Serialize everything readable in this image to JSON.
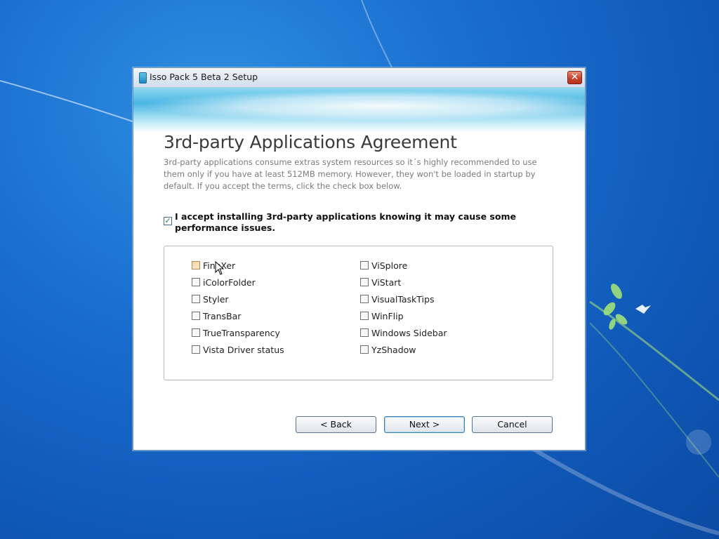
{
  "window": {
    "title": "Isso Pack 5 Beta 2 Setup",
    "close_glyph": "✕"
  },
  "page": {
    "heading": "3rd-party Applications Agreement",
    "description": "3rd-party applications consume extras system resources so it´s highly recommended to use them only if you have at least 512MB memory. However, they won't be loaded in startup by default. If you accept the terms, click the check box below."
  },
  "accept": {
    "checked": true,
    "label": "I accept installing 3rd-party applications knowing it may cause some performance issues."
  },
  "apps": {
    "left": [
      {
        "label": "FineXer",
        "checked": false
      },
      {
        "label": "iColorFolder",
        "checked": false
      },
      {
        "label": "Styler",
        "checked": false
      },
      {
        "label": "TransBar",
        "checked": false
      },
      {
        "label": "TrueTransparency",
        "checked": false
      },
      {
        "label": "Vista Driver status",
        "checked": false
      }
    ],
    "right": [
      {
        "label": "ViSplore",
        "checked": false
      },
      {
        "label": "ViStart",
        "checked": false
      },
      {
        "label": "VisualTaskTips",
        "checked": false
      },
      {
        "label": "WinFlip",
        "checked": false
      },
      {
        "label": "Windows Sidebar",
        "checked": false
      },
      {
        "label": "YzShadow",
        "checked": false
      }
    ]
  },
  "buttons": {
    "back": "< Back",
    "next": "Next >",
    "cancel": "Cancel"
  },
  "colors": {
    "desktop": "#1a6fd0",
    "accept_check": "#1e8a2c",
    "close_button": "#c84732"
  }
}
